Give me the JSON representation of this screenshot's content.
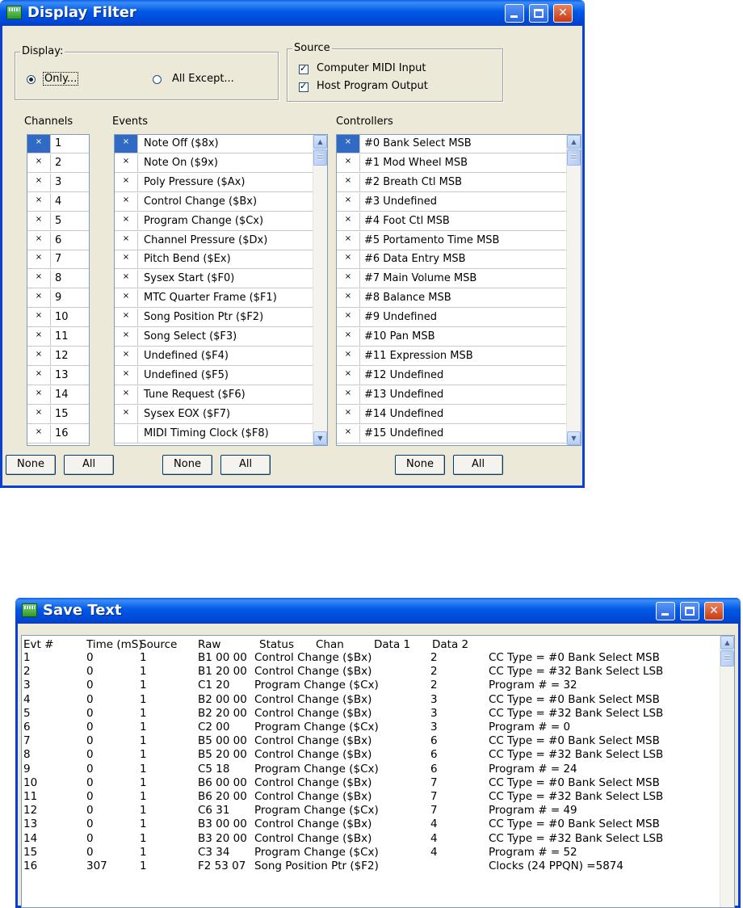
{
  "display_filter": {
    "title": "Display Filter",
    "display_group": {
      "label": "Display:",
      "only": "Only...",
      "all_except": "All Except..."
    },
    "source_group": {
      "label": "Source",
      "computer_midi_input": "Computer MIDI Input",
      "host_program_output": "Host Program Output"
    },
    "channels": {
      "label": "Channels",
      "items": [
        {
          "mark": "×",
          "label": "1"
        },
        {
          "mark": "×",
          "label": "2"
        },
        {
          "mark": "×",
          "label": "3"
        },
        {
          "mark": "×",
          "label": "4"
        },
        {
          "mark": "×",
          "label": "5"
        },
        {
          "mark": "×",
          "label": "6"
        },
        {
          "mark": "×",
          "label": "7"
        },
        {
          "mark": "×",
          "label": "8"
        },
        {
          "mark": "×",
          "label": "9"
        },
        {
          "mark": "×",
          "label": "10"
        },
        {
          "mark": "×",
          "label": "11"
        },
        {
          "mark": "×",
          "label": "12"
        },
        {
          "mark": "×",
          "label": "13"
        },
        {
          "mark": "×",
          "label": "14"
        },
        {
          "mark": "×",
          "label": "15"
        },
        {
          "mark": "×",
          "label": "16"
        }
      ],
      "none_button": "None",
      "all_button": "All"
    },
    "events": {
      "label": "Events",
      "items": [
        {
          "mark": "×",
          "label": "Note Off ($8x)"
        },
        {
          "mark": "×",
          "label": "Note On ($9x)"
        },
        {
          "mark": "×",
          "label": "Poly Pressure ($Ax)"
        },
        {
          "mark": "×",
          "label": "Control Change ($Bx)"
        },
        {
          "mark": "×",
          "label": "Program Change ($Cx)"
        },
        {
          "mark": "×",
          "label": "Channel Pressure ($Dx)"
        },
        {
          "mark": "×",
          "label": "Pitch Bend ($Ex)"
        },
        {
          "mark": "×",
          "label": "Sysex Start ($F0)"
        },
        {
          "mark": "×",
          "label": "MTC Quarter Frame ($F1)"
        },
        {
          "mark": "×",
          "label": "Song Position Ptr ($F2)"
        },
        {
          "mark": "×",
          "label": "Song Select ($F3)"
        },
        {
          "mark": "×",
          "label": "Undefined ($F4)"
        },
        {
          "mark": "×",
          "label": "Undefined ($F5)"
        },
        {
          "mark": "×",
          "label": "Tune Request ($F6)"
        },
        {
          "mark": "×",
          "label": "Sysex EOX ($F7)"
        },
        {
          "mark": "",
          "label": "MIDI Timing Clock ($F8)"
        }
      ],
      "none_button": "None",
      "all_button": "All"
    },
    "controllers": {
      "label": "Controllers",
      "items": [
        {
          "mark": "×",
          "label": "#0 Bank Select MSB"
        },
        {
          "mark": "×",
          "label": "#1 Mod Wheel MSB"
        },
        {
          "mark": "×",
          "label": "#2 Breath Ctl MSB"
        },
        {
          "mark": "×",
          "label": "#3 Undefined"
        },
        {
          "mark": "×",
          "label": "#4 Foot Ctl MSB"
        },
        {
          "mark": "×",
          "label": "#5 Portamento Time MSB"
        },
        {
          "mark": "×",
          "label": "#6 Data Entry MSB"
        },
        {
          "mark": "×",
          "label": "#7 Main Volume MSB"
        },
        {
          "mark": "×",
          "label": "#8 Balance MSB"
        },
        {
          "mark": "×",
          "label": "#9 Undefined"
        },
        {
          "mark": "×",
          "label": "#10 Pan MSB"
        },
        {
          "mark": "×",
          "label": "#11 Expression MSB"
        },
        {
          "mark": "×",
          "label": "#12 Undefined"
        },
        {
          "mark": "×",
          "label": "#13 Undefined"
        },
        {
          "mark": "×",
          "label": "#14 Undefined"
        },
        {
          "mark": "×",
          "label": "#15 Undefined"
        }
      ],
      "none_button": "None",
      "all_button": "All"
    }
  },
  "save_text": {
    "title": "Save Text",
    "headers": [
      "Evt #",
      "Time (mS)",
      "Source",
      "Raw",
      "Status",
      "Chan",
      "Data 1",
      "Data 2"
    ],
    "rows": [
      {
        "evt": "1",
        "time": "0",
        "src": "1",
        "raw": "B1 00 00",
        "status": "Control Change ($Bx)",
        "chan": "2",
        "desc": "CC Type = #0 Bank Select MSB"
      },
      {
        "evt": "2",
        "time": "0",
        "src": "1",
        "raw": "B1 20 00",
        "status": "Control Change ($Bx)",
        "chan": "2",
        "desc": "CC Type = #32 Bank Select LSB"
      },
      {
        "evt": "3",
        "time": "0",
        "src": "1",
        "raw": "C1 20",
        "status": "Program Change ($Cx)",
        "chan": "2",
        "desc": "Program # =  32"
      },
      {
        "evt": "4",
        "time": "0",
        "src": "1",
        "raw": "B2 00 00",
        "status": "Control Change ($Bx)",
        "chan": "3",
        "desc": "CC Type = #0 Bank Select MSB"
      },
      {
        "evt": "5",
        "time": "0",
        "src": "1",
        "raw": "B2 20 00",
        "status": "Control Change ($Bx)",
        "chan": "3",
        "desc": "CC Type = #32 Bank Select LSB"
      },
      {
        "evt": "6",
        "time": "0",
        "src": "1",
        "raw": "C2 00",
        "status": "Program Change ($Cx)",
        "chan": "3",
        "desc": "Program # =  0"
      },
      {
        "evt": "7",
        "time": "0",
        "src": "1",
        "raw": "B5 00 00",
        "status": "Control Change ($Bx)",
        "chan": "6",
        "desc": "CC Type = #0 Bank Select MSB"
      },
      {
        "evt": "8",
        "time": "0",
        "src": "1",
        "raw": "B5 20 00",
        "status": "Control Change ($Bx)",
        "chan": "6",
        "desc": "CC Type = #32 Bank Select LSB"
      },
      {
        "evt": "9",
        "time": "0",
        "src": "1",
        "raw": "C5 18",
        "status": "Program Change ($Cx)",
        "chan": "6",
        "desc": "Program # =  24"
      },
      {
        "evt": "10",
        "time": "0",
        "src": "1",
        "raw": "B6 00 00",
        "status": "Control Change ($Bx)",
        "chan": "7",
        "desc": "CC Type = #0 Bank Select MSB"
      },
      {
        "evt": "11",
        "time": "0",
        "src": "1",
        "raw": "B6 20 00",
        "status": "Control Change ($Bx)",
        "chan": "7",
        "desc": "CC Type = #32 Bank Select LSB"
      },
      {
        "evt": "12",
        "time": "0",
        "src": "1",
        "raw": "C6 31",
        "status": "Program Change ($Cx)",
        "chan": "7",
        "desc": "Program # =  49"
      },
      {
        "evt": "13",
        "time": "0",
        "src": "1",
        "raw": "B3 00 00",
        "status": "Control Change ($Bx)",
        "chan": "4",
        "desc": "CC Type = #0 Bank Select MSB"
      },
      {
        "evt": "14",
        "time": "0",
        "src": "1",
        "raw": "B3 20 00",
        "status": "Control Change ($Bx)",
        "chan": "4",
        "desc": "CC Type = #32 Bank Select LSB"
      },
      {
        "evt": "15",
        "time": "0",
        "src": "1",
        "raw": "C3 34",
        "status": "Program Change ($Cx)",
        "chan": "4",
        "desc": "Program # =  52"
      },
      {
        "evt": "16",
        "time": "307",
        "src": "1",
        "raw": "F2 53 07",
        "status": "Song Position Ptr ($F2)",
        "chan": "",
        "desc": "Clocks (24 PPQN) =5874"
      }
    ]
  }
}
